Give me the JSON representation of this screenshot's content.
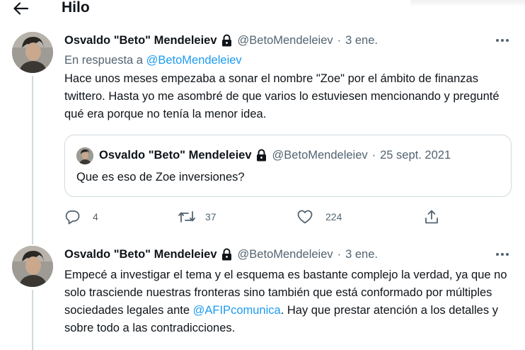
{
  "header": {
    "title": "Hilo"
  },
  "tweets": [
    {
      "author_name": "Osvaldo \"Beto\" Mendeleiev",
      "handle": "@BetoMendeleiev",
      "separator": "·",
      "date": "3 ene.",
      "reply_prefix": "En respuesta a",
      "reply_handle": "@BetoMendeleiev",
      "text": "Hace unos meses empezaba a sonar el nombre \"Zoe\" por el ámbito de finanzas twittero. Hasta yo me asombré de que varios lo estuviesen mencionando y pregunté qué era porque no tenía la menor idea.",
      "quote": {
        "author_name": "Osvaldo \"Beto\" Mendeleiev",
        "handle": "@BetoMendeleiev",
        "separator": "·",
        "date": "25 sept. 2021",
        "text": "Que es eso de Zoe inversiones?"
      },
      "actions": {
        "replies": "4",
        "retweets": "37",
        "likes": "224"
      }
    },
    {
      "author_name": "Osvaldo \"Beto\" Mendeleiev",
      "handle": "@BetoMendeleiev",
      "separator": "·",
      "date": "3 ene.",
      "text_parts": {
        "before": "Empecé a investigar el tema y el esquema es bastante complejo la verdad, ya que no solo trasciende nuestras fronteras sino también que está conformado por múltiples sociedades legales ante ",
        "mention": "@AFIPcomunica",
        "after": ". Hay que prestar atención a los detalles y sobre todo a las contradicciones."
      }
    }
  ],
  "icons": {
    "back": "arrow-left-icon",
    "lock": "lock-icon",
    "more": "more-horizontal-icon",
    "reply": "reply-icon",
    "retweet": "retweet-icon",
    "like": "heart-icon",
    "share": "share-icon"
  },
  "colors": {
    "link": "#1d9bf0",
    "secondary_text": "#536471",
    "text": "#0f1419",
    "border": "#cfd9de"
  }
}
